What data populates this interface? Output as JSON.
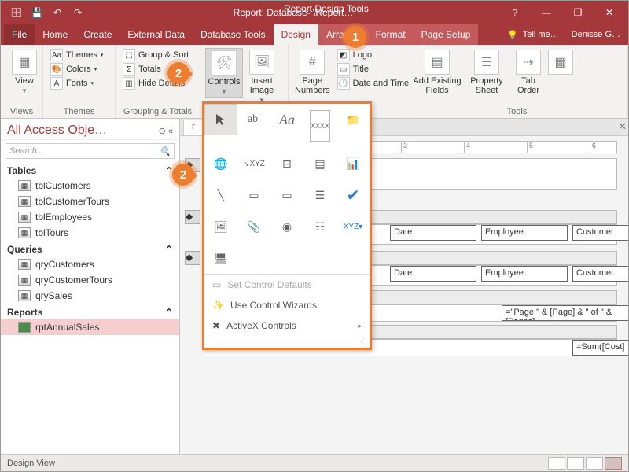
{
  "titlebar": {
    "app_title": "Report: Database- \\Report…",
    "context_title": "Report Design Tools"
  },
  "window_controls": {
    "help": "?",
    "min": "—",
    "restore": "❐",
    "close": "✕"
  },
  "tabs": {
    "file": "File",
    "items": [
      "Home",
      "Create",
      "External Data",
      "Database Tools",
      "Design",
      "Arrange",
      "Format",
      "Page Setup"
    ],
    "active": "Design",
    "tellme": "Tell me…",
    "account": "Denisse G…"
  },
  "ribbon": {
    "views": {
      "label": "Views",
      "button": "View"
    },
    "themes": {
      "label": "Themes",
      "themes": "Themes",
      "colors": "Colors",
      "fonts": "Fonts"
    },
    "grouping": {
      "label": "Grouping & Totals",
      "groupsort": "Group & Sort",
      "totals": "Totals",
      "hide": "Hide Details"
    },
    "controls": {
      "label": "Controls",
      "controls_btn": "Controls",
      "image_btn": "Insert\nImage"
    },
    "hf": {
      "label": "",
      "page_numbers": "Page\nNumbers",
      "logo": "Logo",
      "title": "Title",
      "datetime": "Date and Time"
    },
    "tools": {
      "label": "Tools",
      "addfields": "Add Existing\nFields",
      "prop": "Property\nSheet",
      "taborder": "Tab\nOrder"
    }
  },
  "gallery_icons": [
    "pointer",
    "textbox",
    "label",
    "xxxx",
    "folder",
    "globe",
    "xyz",
    "split",
    "table",
    "chart",
    "line",
    "rect",
    "button",
    "combo",
    "check",
    "image",
    "attach",
    "radio",
    "list",
    "xyz2",
    "subform"
  ],
  "gallery_menu": {
    "defaults": "Set Control Defaults",
    "wizards": "Use Control Wizards",
    "activex": "ActiveX Controls"
  },
  "nav": {
    "header": "All Access Obje…",
    "search_ph": "Search...",
    "groups": [
      {
        "name": "Tables",
        "items": [
          "tblCustomers",
          "tblCustomerTours",
          "tblEmployees",
          "tblTours"
        ]
      },
      {
        "name": "Queries",
        "items": [
          "qryCustomers",
          "qryCustomerTours",
          "qrySales"
        ]
      },
      {
        "name": "Reports",
        "items": [
          "rptAnnualSales"
        ],
        "selected": "rptAnnualSales"
      }
    ]
  },
  "design": {
    "doc_tab": "r",
    "ruler_marks": [
      "3",
      "4",
      "5",
      "6"
    ],
    "headers": [
      "Date",
      "Employee",
      "Customer"
    ],
    "detail_fields": [
      "Date",
      "Employee",
      "Customer"
    ],
    "page_expr": "=\"Page \" & [Page] & \" of \" & [Pages]",
    "sum_expr": "=Sum([Cost]"
  },
  "status": {
    "left": "Design View"
  },
  "callouts": {
    "one": "1",
    "two": "2"
  }
}
